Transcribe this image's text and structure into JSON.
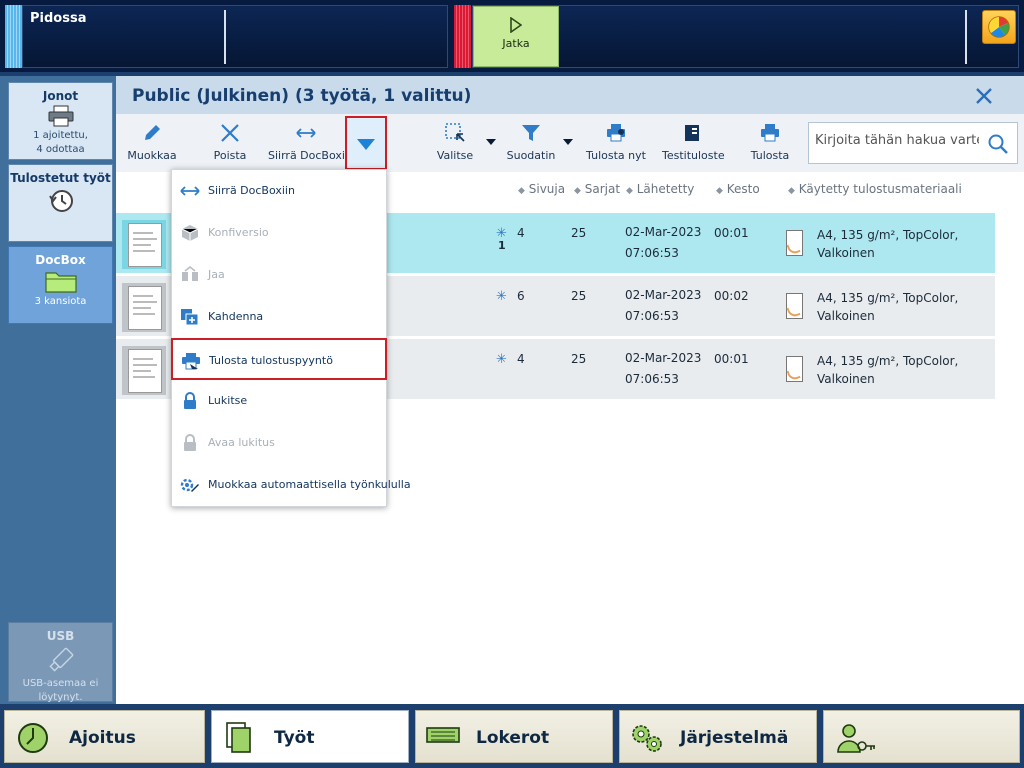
{
  "topbar": {
    "status": "Pidossa",
    "resume_label": "Jatka"
  },
  "sidebar": {
    "queues": {
      "title": "Jonot",
      "line1": "1 ajoitettu,",
      "line2": "4 odottaa"
    },
    "printed": {
      "title": "Tulostetut työt"
    },
    "docbox": {
      "title": "DocBox",
      "sub": "3 kansiota"
    },
    "usb": {
      "title": "USB",
      "line1": "USB-asemaa ei",
      "line2": "löytynyt."
    }
  },
  "main": {
    "title": "Public (Julkinen) (3 työtä, 1 valittu)"
  },
  "toolbar": {
    "edit": "Muokkaa",
    "delete": "Poista",
    "move": "Siirrä DocBoxiin",
    "select": "Valitse",
    "filter": "Suodatin",
    "print_now": "Tulosta nyt",
    "proof": "Testituloste",
    "print": "Tulosta",
    "search_placeholder": "Kirjoita tähän hakua varten"
  },
  "table": {
    "headers": {
      "pages": "Sivuja",
      "sets": "Sarjat",
      "sent": "Lähetetty",
      "duration": "Kesto",
      "media": "Käytetty tulostusmateriaali"
    },
    "rows": [
      {
        "pages": "4",
        "copies_sub": "1",
        "sets": "25",
        "date": "02-Mar-2023",
        "time": "07:06:53",
        "duration": "00:01",
        "media1": "A4, 135 g/m², TopColor,",
        "media2": "Valkoinen",
        "selected": true
      },
      {
        "pages": "6",
        "copies_sub": "",
        "sets": "25",
        "date": "02-Mar-2023",
        "time": "07:06:53",
        "duration": "00:02",
        "media1": "A4, 135 g/m², TopColor,",
        "media2": "Valkoinen",
        "selected": false
      },
      {
        "pages": "4",
        "copies_sub": "",
        "sets": "25",
        "date": "02-Mar-2023",
        "time": "07:06:53",
        "duration": "00:01",
        "media1": "A4, 135 g/m², TopColor,",
        "media2": "Valkoinen",
        "selected": false
      }
    ]
  },
  "menu": {
    "items": [
      {
        "label": "Siirrä DocBoxiin",
        "icon": "move-arrows-icon",
        "disabled": false
      },
      {
        "label": "Konfiversio",
        "icon": "cube-icon",
        "disabled": true
      },
      {
        "label": "Jaa",
        "icon": "split-icon",
        "disabled": true
      },
      {
        "label": "Kahdenna",
        "icon": "duplicate-icon",
        "disabled": false
      },
      {
        "label": "Tulosta tulostuspyyntö",
        "icon": "print-request-icon",
        "disabled": false,
        "highlight": true
      },
      {
        "label": "Lukitse",
        "icon": "lock-icon",
        "disabled": false
      },
      {
        "label": "Avaa lukitus",
        "icon": "unlock-icon",
        "disabled": true
      },
      {
        "label": "Muokkaa automaattisella työnkululla",
        "icon": "auto-workflow-icon",
        "disabled": false
      }
    ]
  },
  "bottom_nav": {
    "schedule": "Ajoitus",
    "jobs": "Työt",
    "trays": "Lokerot",
    "system": "Järjestelmä"
  },
  "colors": {
    "accent": "#1e82d6",
    "highlight_border": "#cc1e24",
    "selected_row": "#ade8f0",
    "resume_button": "#c8eb9a"
  }
}
